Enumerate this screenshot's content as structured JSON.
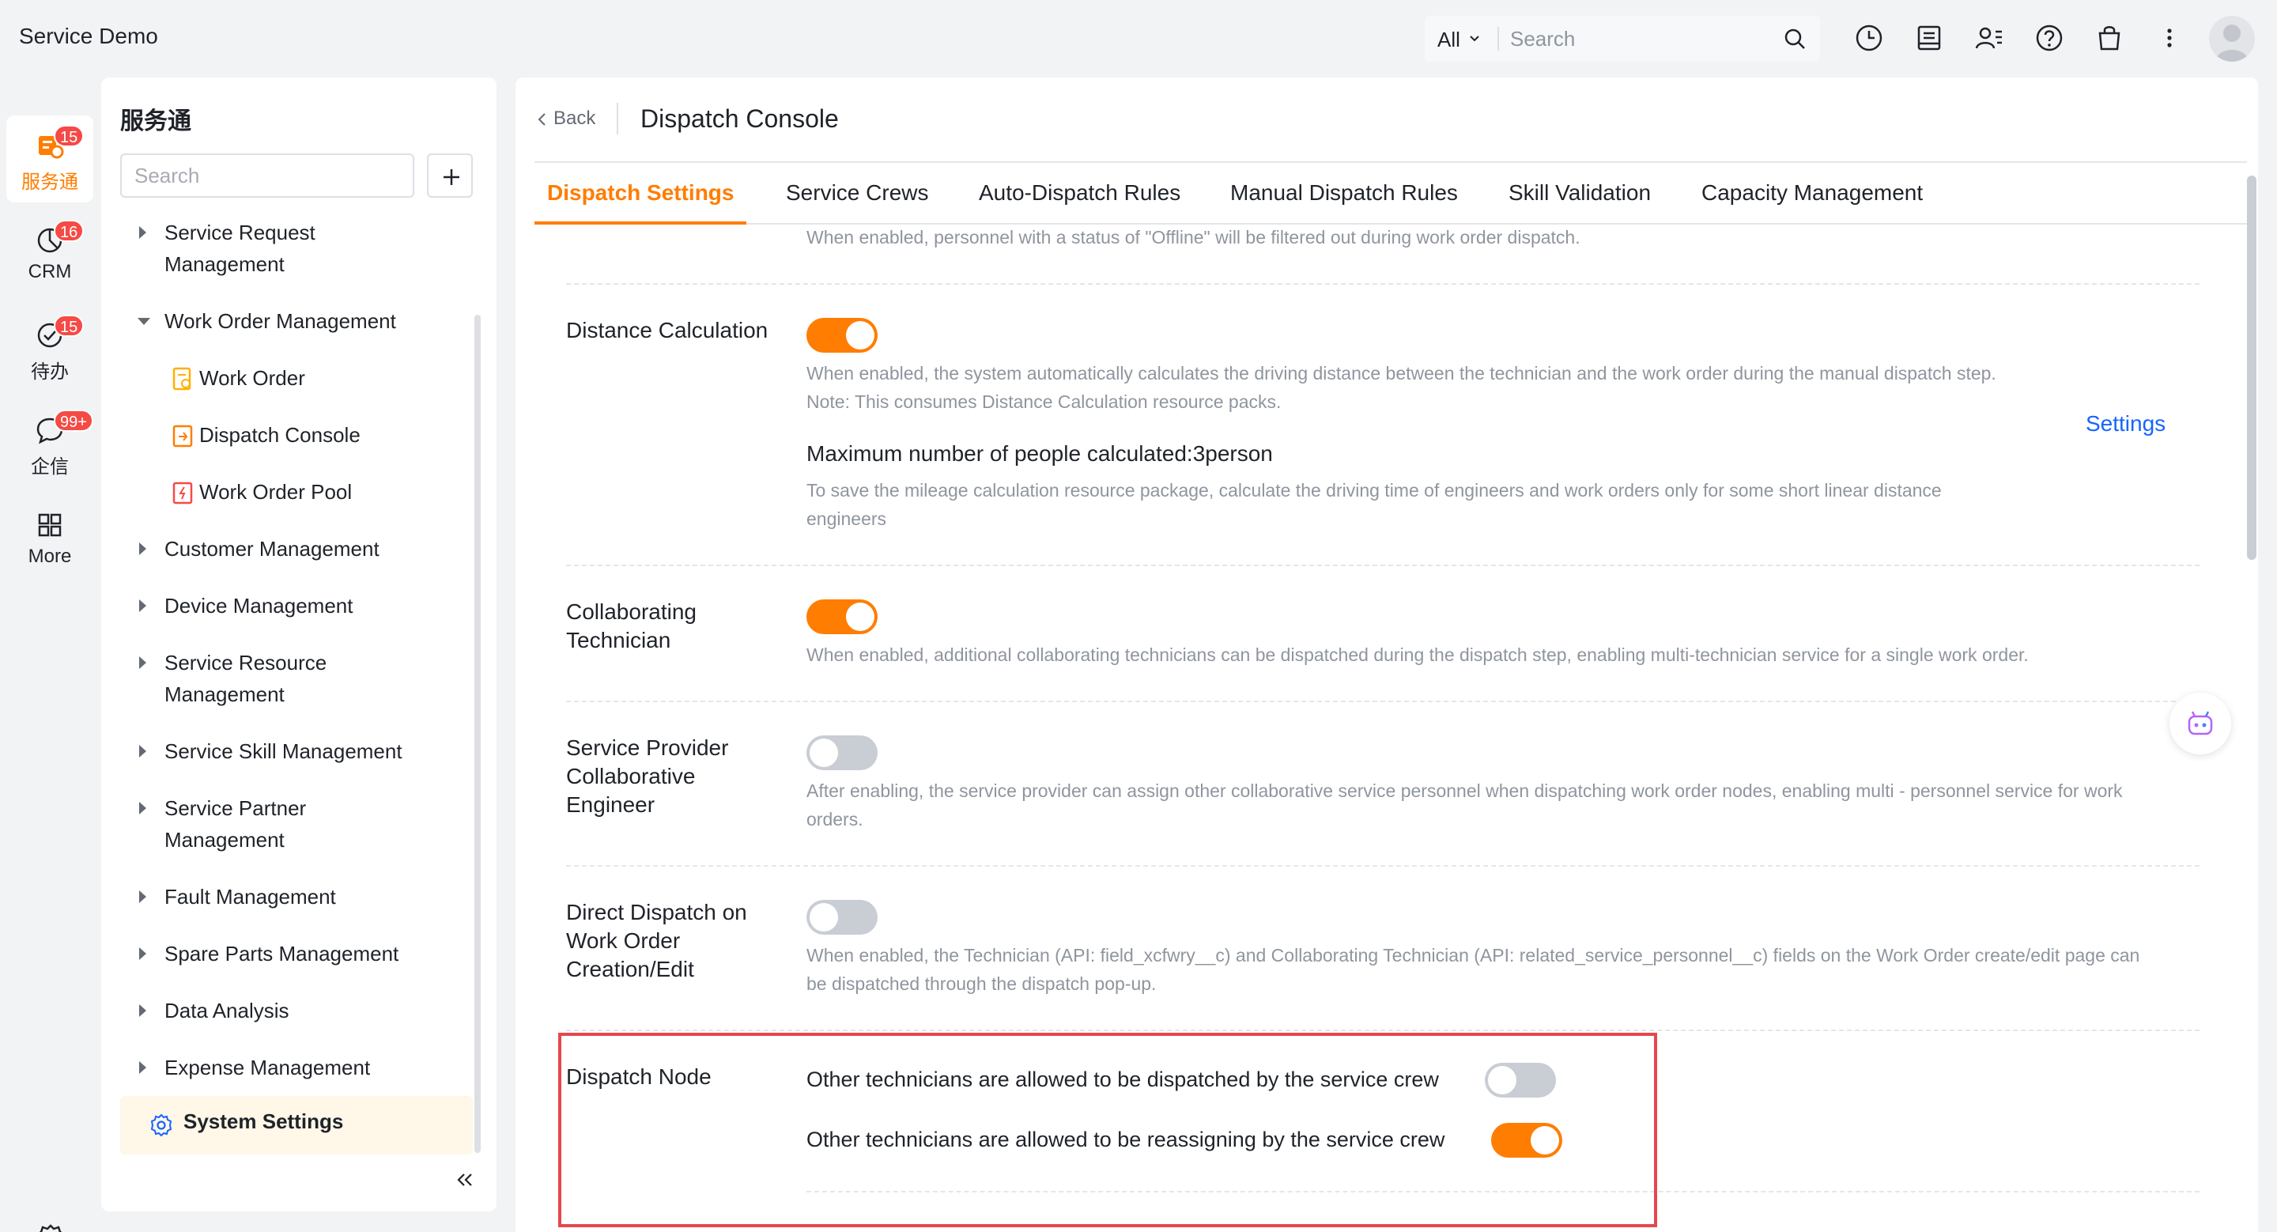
{
  "header": {
    "app_title": "Service Demo",
    "search_scope": "All",
    "search_placeholder": "Search",
    "icons": [
      "history-icon",
      "inbox-icon",
      "contacts-icon",
      "help-icon",
      "shopping-bag-icon",
      "more-vertical-icon",
      "avatar"
    ]
  },
  "rail": {
    "items": [
      {
        "label": "服务通",
        "badge": "15",
        "icon": "service-icon",
        "active": true
      },
      {
        "label": "CRM",
        "badge": "16",
        "icon": "pie-icon"
      },
      {
        "label": "待办",
        "badge": "15",
        "icon": "todo-check-icon"
      },
      {
        "label": "企信",
        "badge": "99+",
        "icon": "chat-icon"
      },
      {
        "label": "More",
        "icon": "grid-icon"
      }
    ],
    "settings_icon": "gear-icon"
  },
  "sidenav": {
    "title": "服务通",
    "search_placeholder": "Search",
    "items": [
      {
        "label_line1": "Service Request",
        "label_line2": "Management"
      },
      {
        "label": "Work Order Management"
      },
      {
        "label": "Work Order"
      },
      {
        "label": "Dispatch Console"
      },
      {
        "label": "Work Order Pool"
      },
      {
        "label": "Customer Management"
      },
      {
        "label": "Device Management"
      },
      {
        "label_line1": "Service Resource",
        "label_line2": "Management"
      },
      {
        "label": "Service Skill Management"
      },
      {
        "label_line1": "Service Partner",
        "label_line2": "Management"
      },
      {
        "label": "Fault Management"
      },
      {
        "label": "Spare Parts Management"
      },
      {
        "label": "Data Analysis"
      },
      {
        "label": "Expense Management"
      },
      {
        "label": "System Settings"
      }
    ]
  },
  "main": {
    "back_label": "Back",
    "title": "Dispatch Console",
    "tabs": [
      {
        "label": "Dispatch Settings",
        "active": true
      },
      {
        "label": "Service Crews"
      },
      {
        "label": "Auto-Dispatch Rules"
      },
      {
        "label": "Manual Dispatch Rules"
      },
      {
        "label": "Skill Validation"
      },
      {
        "label": "Capacity Management"
      }
    ],
    "top_desc": "When enabled, personnel with a status of \"Offline\" will be filtered out during work order dispatch.",
    "distance": {
      "label": "Distance Calculation",
      "enabled": true,
      "desc1": "When enabled, the system automatically calculates the driving distance between the technician and the work order during the manual dispatch step.",
      "desc2": "Note: This consumes Distance Calculation resource packs.",
      "max_people": "Maximum number of people calculated:3person",
      "max_desc1": "To save the mileage calculation resource package, calculate the driving time of engineers and work orders only for some short linear distance",
      "max_desc2": "engineers",
      "settings_link": "Settings"
    },
    "collab": {
      "label_line1": "Collaborating",
      "label_line2": "Technician",
      "enabled": true,
      "desc": "When enabled, additional collaborating technicians can be dispatched during the dispatch step, enabling multi-technician service for a single work order."
    },
    "provider": {
      "label_line1": "Service Provider",
      "label_line2": "Collaborative",
      "label_line3": "Engineer",
      "enabled": false,
      "desc1": "After enabling, the service provider can assign other collaborative service personnel when dispatching work order nodes, enabling multi - personnel service for work",
      "desc2": "orders."
    },
    "direct": {
      "label_line1": "Direct Dispatch on",
      "label_line2": "Work Order",
      "label_line3": "Creation/Edit",
      "enabled": false,
      "desc1": "When enabled, the Technician (API: field_xcfwry__c) and Collaborating Technician (API: related_service_personnel__c) fields on the Work Order create/edit page can",
      "desc2": "be dispatched through the dispatch pop-up."
    },
    "node": {
      "label": "Dispatch Node",
      "opt1": "Other technicians are allowed to be dispatched by the service crew",
      "opt1_enabled": false,
      "opt2": "Other technicians are allowed to be reassigning by the service crew",
      "opt2_enabled": true
    }
  },
  "colors": {
    "accent": "#ff7d00",
    "link": "#1664ff",
    "badge": "#f54a45",
    "highlight_box": "#e5484d"
  }
}
